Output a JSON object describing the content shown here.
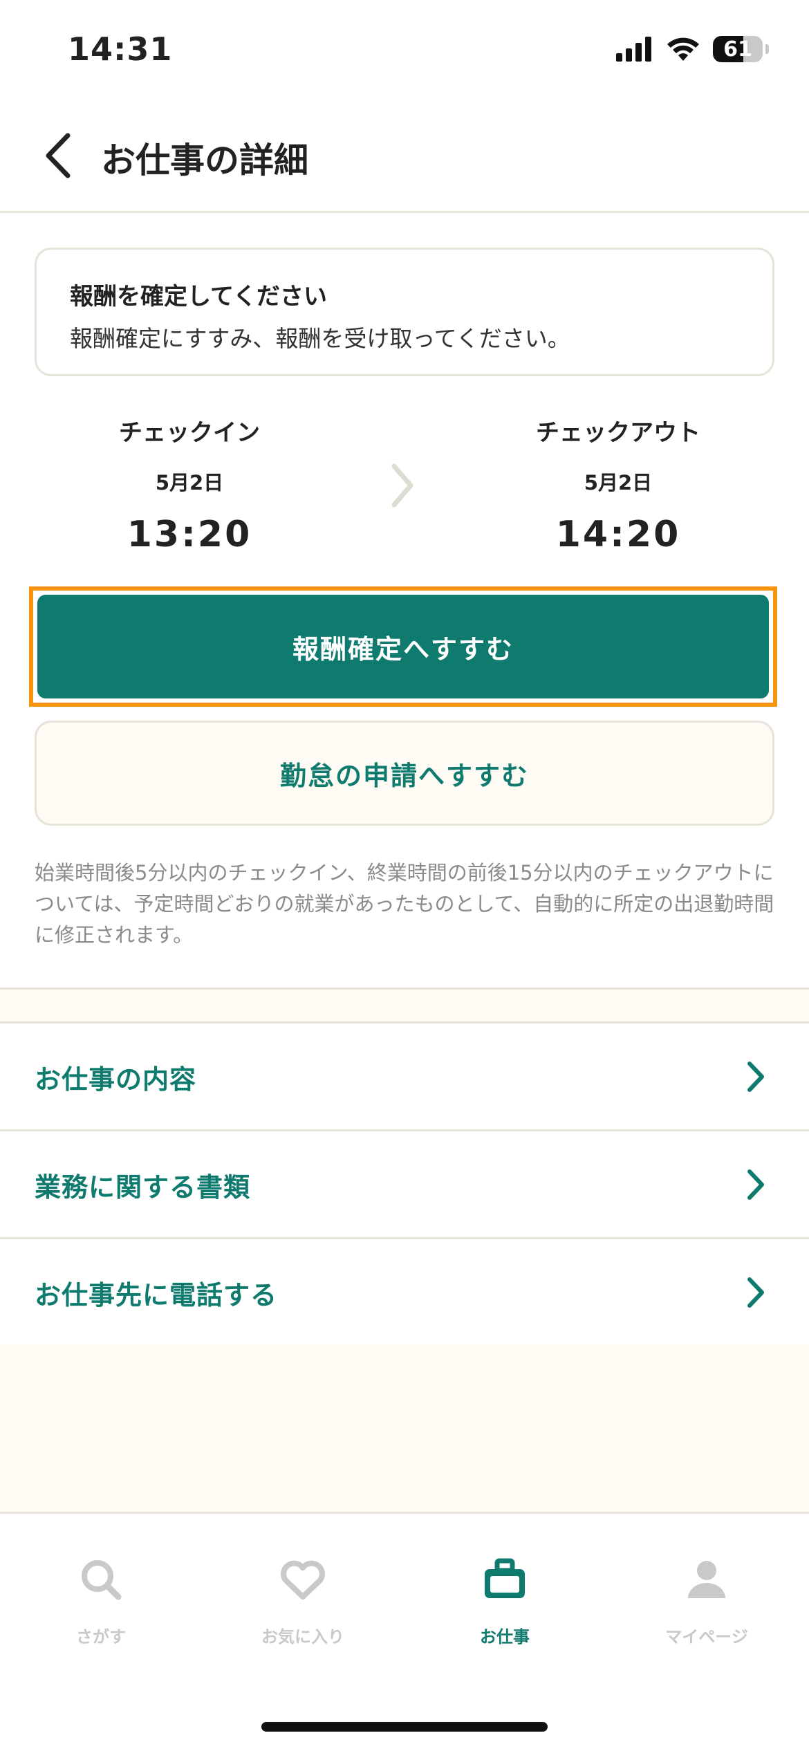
{
  "status_bar": {
    "time": "14:31",
    "battery": "61",
    "battery_level": 0.61
  },
  "header": {
    "title": "お仕事の詳細"
  },
  "notice": {
    "title": "報酬を確定してください",
    "body": "報酬確定にすすみ、報酬を受け取ってください。"
  },
  "checkin": {
    "label": "チェックイン",
    "date": "5月2日",
    "time": "13:20"
  },
  "checkout": {
    "label": "チェックアウト",
    "date": "5月2日",
    "time": "14:20"
  },
  "buttons": {
    "confirm_reward": "報酬確定へすすむ",
    "attendance_request": "勤怠の申請へすすむ"
  },
  "note": "始業時間後5分以内のチェックイン、終業時間の前後15分以内のチェックアウトについては、予定時間どおりの就業があったものとして、自動的に所定の出退勤時間に修正されます。",
  "menu": [
    {
      "label": "お仕事の内容"
    },
    {
      "label": "業務に関する書類"
    },
    {
      "label": "お仕事先に電話する"
    }
  ],
  "tabs": [
    {
      "label": "さがす",
      "icon": "search-icon"
    },
    {
      "label": "お気に入り",
      "icon": "heart-icon"
    },
    {
      "label": "お仕事",
      "icon": "briefcase-icon",
      "active": true
    },
    {
      "label": "マイページ",
      "icon": "person-icon"
    }
  ],
  "colors": {
    "accent": "#0f7a6e",
    "highlight": "#f7950f",
    "inactive_tab": "#c9c9c9"
  }
}
